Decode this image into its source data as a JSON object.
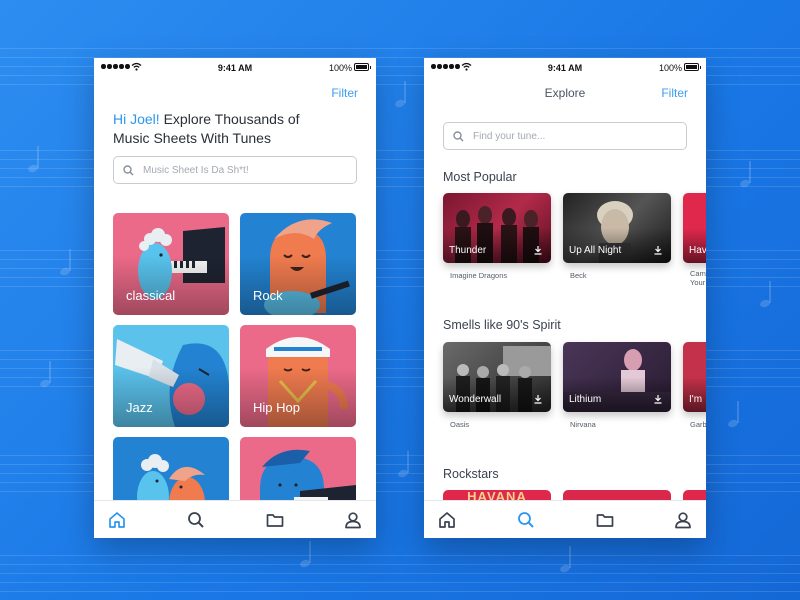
{
  "status": {
    "time": "9:41 AM",
    "battery": "100%"
  },
  "left": {
    "filter": "Filter",
    "greeting": "Hi Joel!",
    "headline": "Explore Thousands of Music Sheets With Tunes",
    "search_placeholder": "Music Sheet Is Da Sh*t!",
    "genres": [
      {
        "label": "classical"
      },
      {
        "label": "Rock"
      },
      {
        "label": "Jazz"
      },
      {
        "label": "Hip Hop"
      },
      {
        "label": ""
      },
      {
        "label": ""
      }
    ],
    "nav": [
      "home-icon",
      "search-icon",
      "folder-icon",
      "profile-icon"
    ]
  },
  "right": {
    "title": "Explore",
    "filter": "Filter",
    "search_placeholder": "Find your tune...",
    "sections": [
      {
        "title": "Most Popular",
        "albums": [
          {
            "song": "Thunder",
            "artist": "Imagine Dragons"
          },
          {
            "song": "Up All Night",
            "artist": "Beck"
          },
          {
            "song": "Hav",
            "artist": "Cam Your"
          }
        ]
      },
      {
        "title": "Smells like 90's Spirit",
        "albums": [
          {
            "song": "Wonderwall",
            "artist": "Oasis"
          },
          {
            "song": "Lithium",
            "artist": "Nirvana"
          },
          {
            "song": "I'm",
            "artist": "Garb"
          }
        ]
      },
      {
        "title": "Rockstars",
        "albums": [
          {
            "song": "",
            "artist": "",
            "art_text": "HAVANA"
          }
        ]
      }
    ],
    "nav": [
      "home-icon",
      "search-icon",
      "folder-icon",
      "profile-icon"
    ]
  },
  "colors": {
    "accent": "#2b96ee",
    "tile_pink": "#ec6a89",
    "tile_blue": "#2383d2",
    "background": "#1a78e6"
  }
}
